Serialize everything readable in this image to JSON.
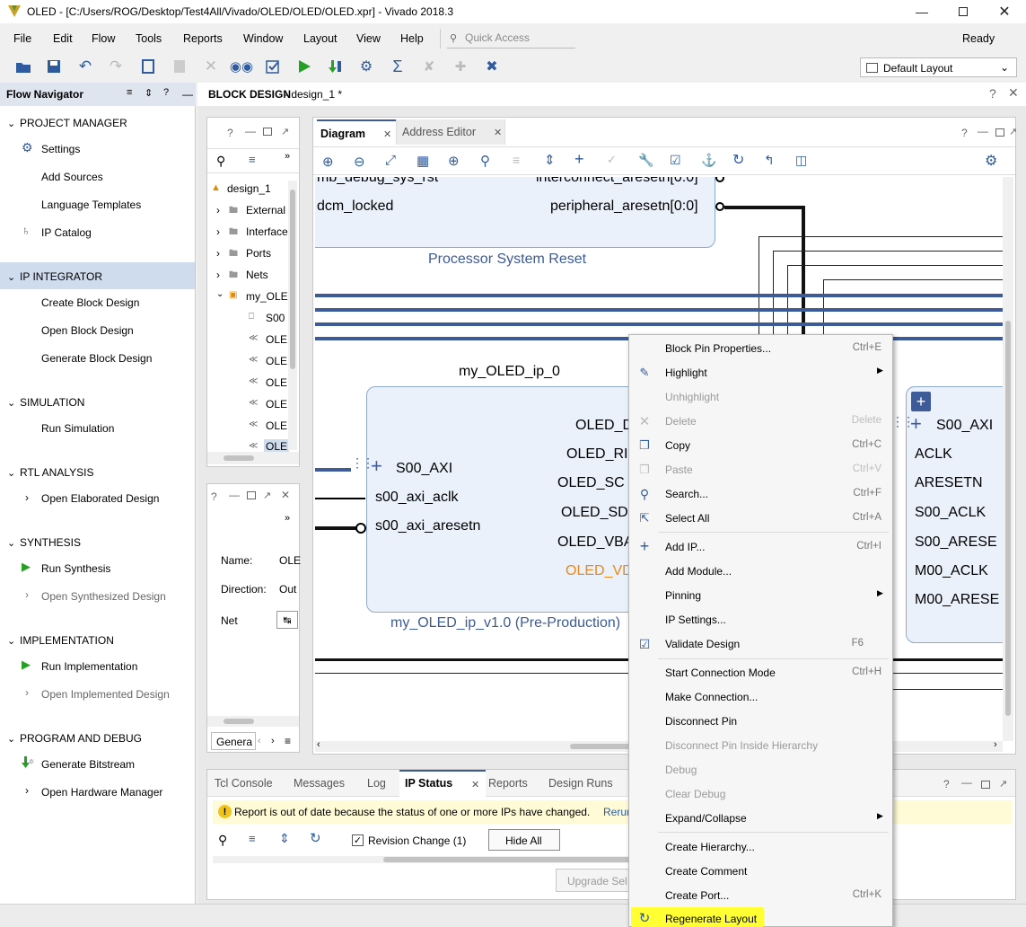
{
  "window": {
    "title": "OLED - [C:/Users/ROG/Desktop/Test4All/Vivado/OLED/OLED/OLED.xpr] - Vivado 2018.3"
  },
  "menubar": {
    "items": [
      "File",
      "Edit",
      "Flow",
      "Tools",
      "Reports",
      "Window",
      "Layout",
      "View",
      "Help"
    ],
    "quick_access_placeholder": "Quick Access",
    "status": "Ready"
  },
  "toolbar": {
    "layout_select": "Default Layout"
  },
  "flow_navigator": {
    "title": "Flow Navigator",
    "sections": [
      {
        "label": "PROJECT MANAGER",
        "items": [
          "Settings",
          "Add Sources",
          "Language Templates",
          "IP Catalog"
        ]
      },
      {
        "label": "IP INTEGRATOR",
        "items": [
          "Create Block Design",
          "Open Block Design",
          "Generate Block Design"
        ]
      },
      {
        "label": "SIMULATION",
        "items": [
          "Run Simulation"
        ]
      },
      {
        "label": "RTL ANALYSIS",
        "items": [
          "Open Elaborated Design"
        ]
      },
      {
        "label": "SYNTHESIS",
        "items": [
          "Run Synthesis",
          "Open Synthesized Design"
        ]
      },
      {
        "label": "IMPLEMENTATION",
        "items": [
          "Run Implementation",
          "Open Implemented Design"
        ]
      },
      {
        "label": "PROGRAM AND DEBUG",
        "items": [
          "Generate Bitstream",
          "Open Hardware Manager"
        ]
      }
    ]
  },
  "block_design": {
    "title": "BLOCK DESIGN",
    "design_name": "- design_1 *"
  },
  "sources_tree": {
    "root": "design_1",
    "folders": [
      "External",
      "Interface",
      "Ports",
      "Nets",
      "my_OLE"
    ],
    "children": [
      "S00",
      "OLE",
      "OLE",
      "OLE",
      "OLE",
      "OLE",
      "OLE"
    ]
  },
  "properties": {
    "name_label": "Name:",
    "name_value": "OLE",
    "direction_label": "Direction:",
    "direction_value": "Out",
    "net_label": "Net",
    "tab_general": "Genera"
  },
  "diagram_tabs": {
    "diagram": "Diagram",
    "address_editor": "Address Editor"
  },
  "diagram": {
    "psr_pins_left": [
      "mb_debug_sys_rst",
      "dcm_locked"
    ],
    "psr_pins_right": [
      "interconnect_aresetn[0:0]",
      "peripheral_aresetn[0:0]"
    ],
    "psr_name": "Processor System Reset",
    "ip_instance": "my_OLED_ip_0",
    "ip_left_pins": [
      "S00_AXI",
      "s00_axi_aclk",
      "s00_axi_aresetn"
    ],
    "ip_right_pins": [
      "OLED_D",
      "OLED_RI",
      "OLED_SC",
      "OLED_SD",
      "OLED_VBA",
      "OLED_VD"
    ],
    "ip_name": "my_OLED_ip_v1.0 (Pre-Production)",
    "ic_pins": [
      "S00_AXI",
      "ACLK",
      "ARESETN",
      "S00_ACLK",
      "S00_ARESE",
      "M00_ACLK",
      "M00_ARESE"
    ]
  },
  "bottom_panel": {
    "tabs": [
      "Tcl Console",
      "Messages",
      "Log",
      "IP Status",
      "Reports",
      "Design Runs"
    ],
    "active_tab": "IP Status",
    "warning": "Report is out of date because the status of one or more IPs have changed.",
    "warning_link": "Rerun",
    "revision_change": "Revision Change (1)",
    "hide_all": "Hide All",
    "upgrade": "Upgrade Sel"
  },
  "context_menu": {
    "items": [
      {
        "label": "Block Pin Properties...",
        "shortcut": "Ctrl+E",
        "disabled": false
      },
      {
        "label": "Highlight",
        "shortcut": "",
        "disabled": false,
        "submenu": true
      },
      {
        "label": "Unhighlight",
        "shortcut": "",
        "disabled": true
      },
      {
        "label": "Delete",
        "shortcut": "Delete",
        "disabled": true
      },
      {
        "label": "Copy",
        "shortcut": "Ctrl+C",
        "disabled": false
      },
      {
        "label": "Paste",
        "shortcut": "Ctrl+V",
        "disabled": true
      },
      {
        "label": "Search...",
        "shortcut": "Ctrl+F",
        "disabled": false
      },
      {
        "label": "Select All",
        "shortcut": "Ctrl+A",
        "disabled": false
      },
      {
        "label": "Add IP...",
        "shortcut": "Ctrl+I",
        "disabled": false
      },
      {
        "label": "Add Module...",
        "shortcut": "",
        "disabled": false
      },
      {
        "label": "Pinning",
        "shortcut": "",
        "disabled": false,
        "submenu": true
      },
      {
        "label": "IP Settings...",
        "shortcut": "",
        "disabled": false
      },
      {
        "label": "Validate Design",
        "shortcut": "F6",
        "disabled": false
      },
      {
        "label": "Start Connection Mode",
        "shortcut": "Ctrl+H",
        "disabled": false
      },
      {
        "label": "Make Connection...",
        "shortcut": "",
        "disabled": false
      },
      {
        "label": "Disconnect Pin",
        "shortcut": "",
        "disabled": false
      },
      {
        "label": "Disconnect Pin Inside Hierarchy",
        "shortcut": "",
        "disabled": true
      },
      {
        "label": "Debug",
        "shortcut": "",
        "disabled": true
      },
      {
        "label": "Clear Debug",
        "shortcut": "",
        "disabled": true
      },
      {
        "label": "Expand/Collapse",
        "shortcut": "",
        "disabled": false,
        "submenu": true
      },
      {
        "label": "Create Hierarchy...",
        "shortcut": "",
        "disabled": false
      },
      {
        "label": "Create Comment",
        "shortcut": "",
        "disabled": false
      },
      {
        "label": "Create Port...",
        "shortcut": "Ctrl+K",
        "disabled": false
      },
      {
        "label": "Regenerate Layout",
        "shortcut": "",
        "disabled": false,
        "highlighted": true
      }
    ]
  },
  "colors": {
    "accent": "#3d5a99",
    "nav_selected": "#cfdcee",
    "highlight": "#ffff33",
    "diagram_block": "#eaf1fb",
    "warning_bg": "#fffbd6"
  }
}
